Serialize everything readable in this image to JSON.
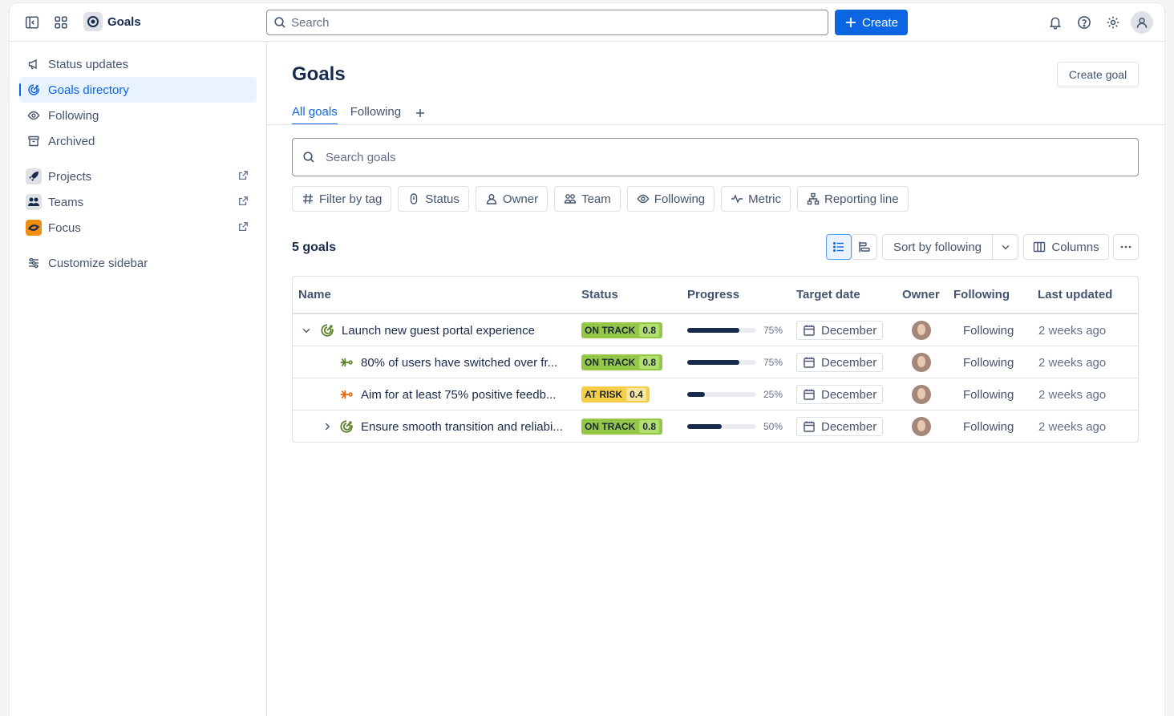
{
  "app": {
    "name": "Goals"
  },
  "topnav": {
    "search_placeholder": "Search",
    "create_label": "Create"
  },
  "sidebar": {
    "items": [
      {
        "label": "Status updates"
      },
      {
        "label": "Goals directory"
      },
      {
        "label": "Following"
      },
      {
        "label": "Archived"
      },
      {
        "label": "Projects"
      },
      {
        "label": "Teams"
      },
      {
        "label": "Focus"
      },
      {
        "label": "Customize sidebar"
      }
    ]
  },
  "main": {
    "title": "Goals",
    "create_goal_label": "Create goal",
    "tabs": [
      {
        "label": "All goals"
      },
      {
        "label": "Following"
      }
    ],
    "search_placeholder": "Search goals",
    "filters": [
      {
        "label": "Filter by tag"
      },
      {
        "label": "Status"
      },
      {
        "label": "Owner"
      },
      {
        "label": "Team"
      },
      {
        "label": "Following"
      },
      {
        "label": "Metric"
      },
      {
        "label": "Reporting line"
      }
    ],
    "goal_count": "5 goals",
    "sort_label": "Sort by following",
    "columns_label": "Columns"
  },
  "table": {
    "headers": [
      "Name",
      "Status",
      "Progress",
      "Target date",
      "Owner",
      "Following",
      "Last updated"
    ],
    "rows": [
      {
        "name": "Launch new guest portal experience",
        "status": "ON TRACK",
        "score": "0.8",
        "progress": 0.75,
        "pct": "75%",
        "target": "December",
        "following": "Following",
        "updated": "2 weeks ago"
      },
      {
        "name": "80% of users have switched over fr...",
        "status": "ON TRACK",
        "score": "0.8",
        "progress": 0.75,
        "pct": "75%",
        "target": "December",
        "following": "Following",
        "updated": "2 weeks ago"
      },
      {
        "name": "Aim for at least 75% positive feedb...",
        "status": "AT RISK",
        "score": "0.4",
        "progress": 0.25,
        "pct": "25%",
        "target": "December",
        "following": "Following",
        "updated": "2 weeks ago"
      },
      {
        "name": "Ensure smooth transition and reliabi...",
        "status": "ON TRACK",
        "score": "0.8",
        "progress": 0.5,
        "pct": "50%",
        "target": "December",
        "following": "Following",
        "updated": "2 weeks ago"
      }
    ]
  },
  "colors": {
    "accent": "#0c66e4",
    "on_track": "#94c748",
    "at_risk": "#f5cd47"
  }
}
